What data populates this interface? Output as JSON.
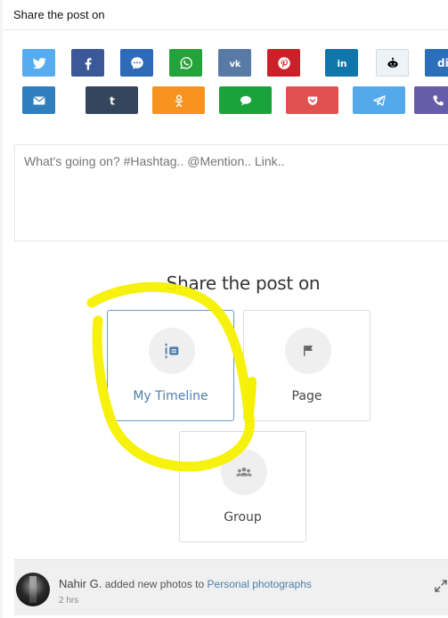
{
  "header": {
    "title": "Share the post on"
  },
  "share_buttons_row1": [
    {
      "name": "twitter",
      "color": "#55acee",
      "icon": "twitter-icon"
    },
    {
      "name": "facebook",
      "color": "#3b5998",
      "icon": "facebook-icon"
    },
    {
      "name": "messenger",
      "color": "#2d6bb8",
      "icon": "messenger-icon"
    },
    {
      "name": "whatsapp",
      "color": "#25a33b",
      "icon": "whatsapp-icon"
    },
    {
      "name": "vk",
      "color": "#587ba5",
      "icon": "vk-icon"
    },
    {
      "name": "pinterest",
      "color": "#cb2027",
      "icon": "pinterest-icon"
    },
    {
      "name": "linkedin",
      "color": "#0e76a8",
      "icon": "linkedin-icon"
    },
    {
      "name": "reddit",
      "color": "#eef3f8",
      "icon": "reddit-icon"
    },
    {
      "name": "digg",
      "color": "#2a6fb8",
      "icon": "digg-icon",
      "label": "digg"
    }
  ],
  "share_buttons_row2": [
    {
      "name": "email",
      "color": "#2f7fbf",
      "icon": "email-icon"
    },
    {
      "name": "tumblr",
      "color": "#35465c",
      "icon": "tumblr-icon"
    },
    {
      "name": "odnoklassniki",
      "color": "#f7931e",
      "icon": "odnoklassniki-icon"
    },
    {
      "name": "sms",
      "color": "#1aa33b",
      "icon": "sms-icon"
    },
    {
      "name": "pocket",
      "color": "#e05250",
      "icon": "pocket-icon"
    },
    {
      "name": "telegram",
      "color": "#54a9eb",
      "icon": "telegram-icon"
    },
    {
      "name": "viber",
      "color": "#665ca7",
      "icon": "viber-icon"
    }
  ],
  "composer": {
    "placeholder": "What's going on? #Hashtag.. @Mention.. Link.."
  },
  "share_target": {
    "title": "Share the post on",
    "options": [
      {
        "label": "My Timeline",
        "icon": "timeline-icon",
        "selected": true
      },
      {
        "label": "Page",
        "icon": "flag-icon",
        "selected": false
      },
      {
        "label": "Group",
        "icon": "group-icon",
        "selected": false
      }
    ]
  },
  "annotation": {
    "color": "#f5f000",
    "shape": "hand-drawn circle around My Timeline"
  },
  "feed_item": {
    "author": "Nahir G.",
    "action": "added new photos to",
    "album": "Personal photographs",
    "time": "2 hrs"
  }
}
